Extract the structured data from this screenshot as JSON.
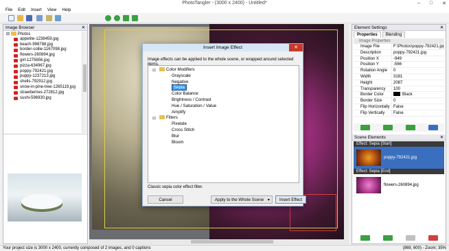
{
  "window": {
    "title": "PhotoTangler - (3000 x 2400) - Untitled*",
    "min_icon": "minimize-icon",
    "max_icon": "maximize-icon",
    "close_icon": "close-icon"
  },
  "menu": [
    "File",
    "Edit",
    "Insert",
    "View",
    "Help"
  ],
  "toolbar": {
    "icons": [
      "new-icon",
      "open-icon",
      "save-icon",
      "export-icon",
      "image-icon",
      "insert-icon",
      "rotate-left-icon",
      "rotate-right-icon",
      "fit-icon",
      "zoom-icon"
    ]
  },
  "image_browser": {
    "title": "Image Browser",
    "folder": "Photos",
    "files": [
      "appetite-1238459.jpg",
      "beach-998788.jpg",
      "border-collie-1167098.jpg",
      "flowers-260894.jpg",
      "girl-1275656.jpg",
      "pizza-634967.jpg",
      "poppy-792421.jpg",
      "puppy-1237213.jpg",
      "shells-792912.jpg",
      "snow-in-pine-tree-1265119.jpg",
      "strawberries-272812.jpg",
      "sushi-596930.jpg"
    ]
  },
  "element_settings": {
    "title": "Element Settings",
    "tabs": [
      "Properties",
      "Blending"
    ],
    "section": "Image Properties",
    "properties": [
      {
        "k": "Image File",
        "v": "F:\\Photos\\poppy-792421.jpg"
      },
      {
        "k": "Description",
        "v": "poppy-792421.jpg"
      },
      {
        "k": "Position X",
        "v": "-949"
      },
      {
        "k": "Position Y",
        "v": "-566"
      },
      {
        "k": "Rotation Angle",
        "v": "0"
      },
      {
        "k": "Width",
        "v": "3181"
      },
      {
        "k": "Height",
        "v": "2087"
      },
      {
        "k": "Transparency",
        "v": "100"
      },
      {
        "k": "Border Color",
        "v": "Black"
      },
      {
        "k": "Border Size",
        "v": "0"
      },
      {
        "k": "Flip Horizontally",
        "v": "False"
      },
      {
        "k": "Flip Vertically",
        "v": "False"
      }
    ]
  },
  "scene_elements": {
    "title": "Scene Elements",
    "items": [
      {
        "effect": "Effect: Sepia [Start]",
        "name": "poppy-792421.jpg"
      },
      {
        "effect": "Effect: Sepia [End]",
        "name": "flowers-260894.jpg"
      }
    ]
  },
  "dialog": {
    "title": "Insert Image Effect",
    "description": "Image effects can be applied to the whole scene, or wrapped around selected items.",
    "groups": [
      {
        "name": "Color Modifiers",
        "items": [
          "Grayscale",
          "Negative",
          "Sepia",
          "Color Balance",
          "Brightness / Contrast",
          "Hue / Saturation / Value",
          "Amplify"
        ]
      },
      {
        "name": "Filters",
        "items": [
          "Pixelate",
          "Cross Stitch",
          "Blur",
          "Bloom"
        ]
      }
    ],
    "selected": "Sepia",
    "status": "Classic sepia color effect filter.",
    "cancel": "Cancel",
    "apply_option": "Apply to the Whole Scene",
    "insert": "Insert Effect"
  },
  "status": {
    "left": "Your project size is 3000 x 2400, currently composed of 2 images, and 0 captions",
    "right": "(869, 600) - Zoom: 35%"
  },
  "colors": {
    "accent": "#3a6fc0",
    "close": "#c7392b",
    "effect_header": "#3a3a3a"
  }
}
